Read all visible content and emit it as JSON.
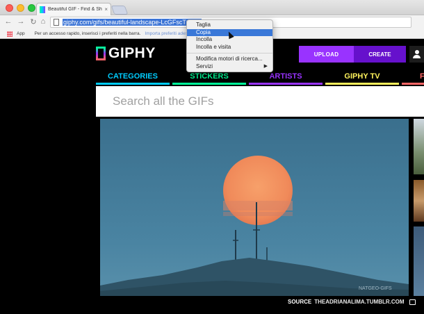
{
  "browser": {
    "tab_title": "Beautiful GIF - Find & Share",
    "tab_close": "×",
    "url": "giphy.com/gifs/beautiful-landscape-LcGFscTzOn8",
    "bookmarks": {
      "apps_label": "App",
      "hint": "Per un accesso rapido, inserisci i preferiti nella barra.",
      "import_link": "Importa preferiti adesso..."
    }
  },
  "header": {
    "logo_text": "GIPHY",
    "upload_label": "UPLOAD",
    "create_label": "CREATE"
  },
  "nav": [
    {
      "label": "CATEGORIES",
      "color": "#00ccff"
    },
    {
      "label": "STICKERS",
      "color": "#00ff99"
    },
    {
      "label": "ARTISTS",
      "color": "#9933ff"
    },
    {
      "label": "GIPHY TV",
      "color": "#fff35c"
    },
    {
      "label": "F",
      "color": "#ff6666"
    }
  ],
  "search": {
    "placeholder": "Search all the GIFs"
  },
  "gif": {
    "watermark": "NATGEO-GIFS"
  },
  "source": {
    "label": "SOURCE",
    "value": "THEADRIANALIMA.TUMBLR.COM"
  },
  "context_menu": {
    "items": [
      {
        "label": "Taglia"
      },
      {
        "label": "Copia",
        "highlighted": true
      },
      {
        "label": "Incolla"
      },
      {
        "label": "Incolla e visita"
      },
      {
        "label": "Modifica motori di ricerca..."
      },
      {
        "label": "Servizi",
        "submenu_arrow": "▶"
      }
    ]
  }
}
